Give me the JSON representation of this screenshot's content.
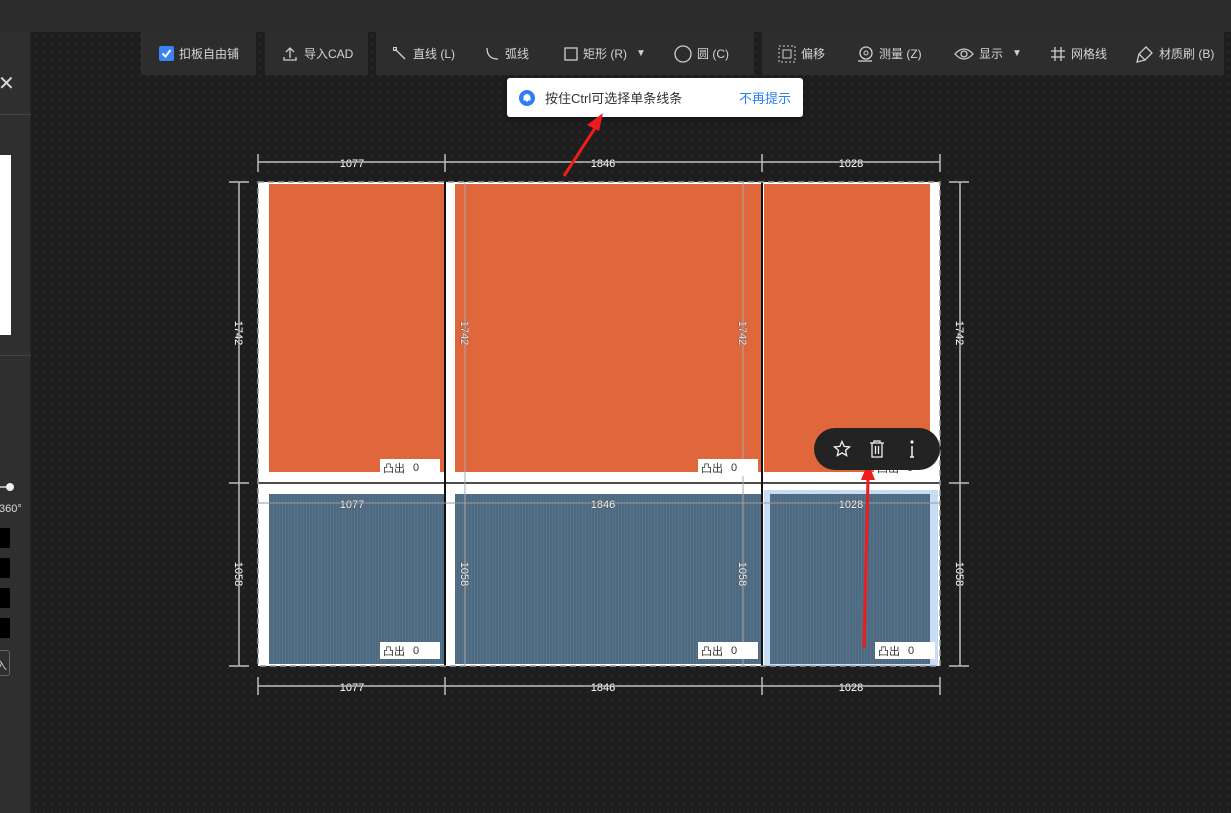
{
  "toolbar": {
    "free_tile_label": "扣板自由铺",
    "free_tile_checked": true,
    "import_cad_label": "导入CAD",
    "line_label": "直线 (L)",
    "arc_label": "弧线",
    "rect_label": "矩形 (R)",
    "circle_label": "圆 (C)",
    "offset_label": "偏移",
    "measure_label": "测量 (Z)",
    "display_label": "显示",
    "grid_label": "网格线",
    "material_brush_label": "材质刷 (B)"
  },
  "left_panel": {
    "rotation_label": "360°",
    "button_label": "入"
  },
  "tip": {
    "message": "按住Ctrl可选择单条线条",
    "dismiss_link": "不再提示"
  },
  "dimensions": {
    "top_widths": [
      "1077",
      "1846",
      "1028"
    ],
    "middle_widths": [
      "1077",
      "1846",
      "1028"
    ],
    "bottom_widths": [
      "1077",
      "1846",
      "1028"
    ],
    "upper_row_height": "1742",
    "lower_row_height": "1058"
  },
  "panel_labels": {
    "prefix": "凸出",
    "upper": [
      "0",
      "0",
      "0"
    ],
    "lower": [
      "0",
      "0",
      "0"
    ]
  },
  "colors": {
    "upper_panel_fill": "#e0663c",
    "lower_panel_fill": "#4e6a80",
    "tip_accent": "#2d7ef5",
    "annotation_arrow": "#ee1c1c"
  },
  "context_menu": {
    "icons": [
      "star-icon",
      "trash-icon",
      "info-icon"
    ]
  }
}
